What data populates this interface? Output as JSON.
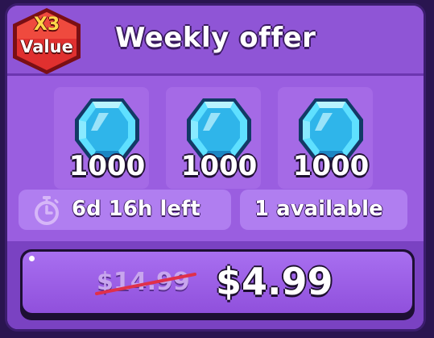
{
  "badge": {
    "multiplier": "X3",
    "label": "Value"
  },
  "header": {
    "title": "Weekly offer"
  },
  "rewards": [
    {
      "icon": "diamond-gem-icon",
      "amount": "1000"
    },
    {
      "icon": "diamond-gem-icon",
      "amount": "1000"
    },
    {
      "icon": "diamond-gem-icon",
      "amount": "1000"
    }
  ],
  "timer": {
    "icon": "stopwatch-icon",
    "text": "6d 16h left"
  },
  "availability": {
    "text": "1 available"
  },
  "purchase": {
    "original_price": "$14.99",
    "price": "$4.99"
  },
  "colors": {
    "panel": "#8a4fd0",
    "badge_red": "#d8262a",
    "gem_blue": "#4fd6ff",
    "strike_red": "#e0304a"
  }
}
